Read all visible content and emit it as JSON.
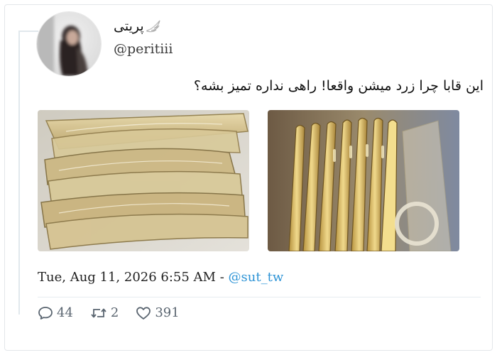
{
  "tweet": {
    "display_name": "پریتی",
    "handle": "@peritiii",
    "text": "این قابا چرا زرد میشن واقعا! راهی نداره تمیز بشه؟",
    "timestamp": "Tue, Aug 11, 2026 6:55 AM",
    "separator": " - ",
    "via_handle": "@sut_tw"
  },
  "photos": [
    {
      "subject": "stack-of-yellowed-clear-phone-cases"
    },
    {
      "subject": "row-of-yellowed-clear-phone-cases-standing"
    }
  ],
  "metrics": {
    "replies": "44",
    "retweets": "2",
    "likes": "391"
  },
  "icons": {
    "name_badge": "angel-wing-icon",
    "reply": "speech-bubble-icon",
    "retweet": "retweet-arrows-icon",
    "like": "heart-icon"
  },
  "colors": {
    "link": "#2e94d6",
    "icon_gray": "#5a6570",
    "divider": "#e6ecf0"
  }
}
